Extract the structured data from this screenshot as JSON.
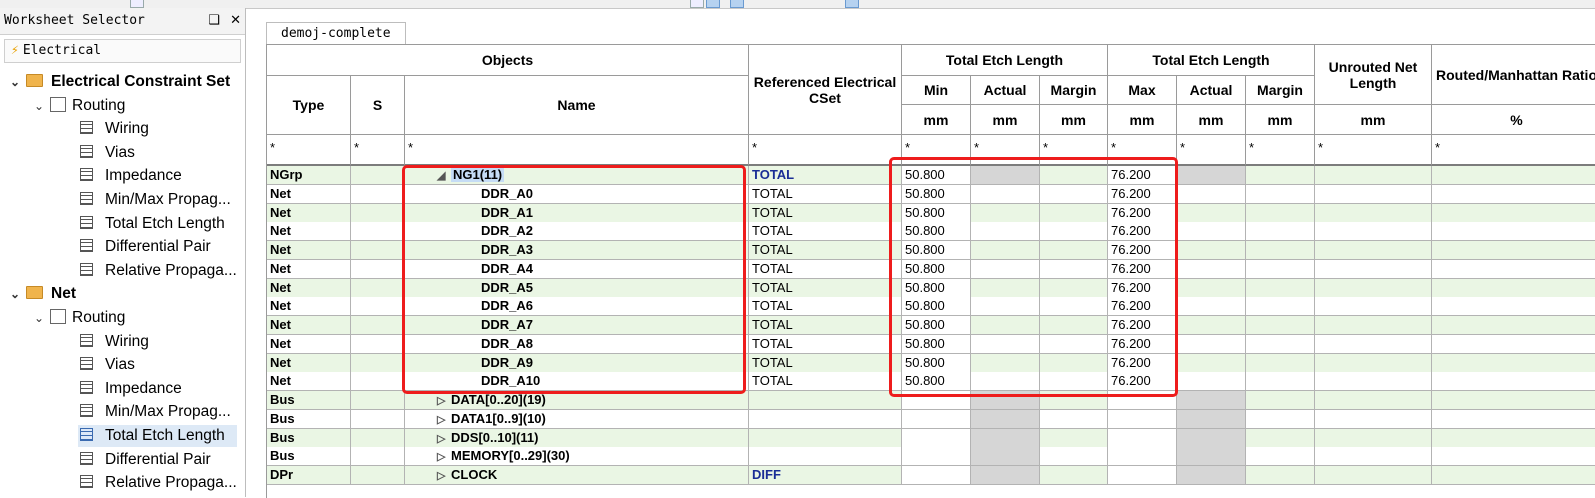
{
  "worksheet_selector": {
    "title": "Worksheet Selector",
    "pin_label": "❑",
    "close_label": "✕",
    "tab_label": "Electrical",
    "tree": [
      {
        "level": 0,
        "label": "Electrical Constraint Set",
        "kind": "folder",
        "expanded": true
      },
      {
        "level": 1,
        "label": "Routing",
        "kind": "routing",
        "expanded": true
      },
      {
        "level": 2,
        "label": "Wiring",
        "kind": "sheet"
      },
      {
        "level": 2,
        "label": "Vias",
        "kind": "sheet"
      },
      {
        "level": 2,
        "label": "Impedance",
        "kind": "sheet"
      },
      {
        "level": 2,
        "label": "Min/Max Propag...",
        "kind": "sheet"
      },
      {
        "level": 2,
        "label": "Total Etch Length",
        "kind": "sheet"
      },
      {
        "level": 2,
        "label": "Differential Pair",
        "kind": "sheet"
      },
      {
        "level": 2,
        "label": "Relative Propaga...",
        "kind": "sheet"
      },
      {
        "level": 0,
        "label": "Net",
        "kind": "folder",
        "expanded": true
      },
      {
        "level": 1,
        "label": "Routing",
        "kind": "routing",
        "expanded": true
      },
      {
        "level": 2,
        "label": "Wiring",
        "kind": "sheet"
      },
      {
        "level": 2,
        "label": "Vias",
        "kind": "sheet"
      },
      {
        "level": 2,
        "label": "Impedance",
        "kind": "sheet"
      },
      {
        "level": 2,
        "label": "Min/Max Propag...",
        "kind": "sheet"
      },
      {
        "level": 2,
        "label": "Total Etch Length",
        "kind": "sheet",
        "selected": true
      },
      {
        "level": 2,
        "label": "Differential Pair",
        "kind": "sheet"
      },
      {
        "level": 2,
        "label": "Relative Propaga...",
        "kind": "sheet"
      }
    ]
  },
  "document_tab": "demoj-complete",
  "headers": {
    "objects": "Objects",
    "type": "Type",
    "s": "S",
    "name": "Name",
    "ref_cset": "Referenced Electrical CSet",
    "tel_min_group": "Total Etch Length",
    "tel_max_group": "Total Etch Length",
    "min": "Min",
    "actual1": "Actual",
    "margin1": "Margin",
    "max": "Max",
    "actual2": "Actual",
    "margin2": "Margin",
    "unrouted": "Unrouted Net Length",
    "ratio": "Routed/Manhattan Ratio",
    "unit_mm": "mm",
    "unit_pct": "%",
    "filter": "*"
  },
  "rows": [
    {
      "type": "NGrp",
      "name": "NG1(11)",
      "expand": "◢",
      "indent": 1,
      "ref": "TOTAL",
      "ref_blue": true,
      "min": "50.800",
      "max": "76.200",
      "selected": true
    },
    {
      "type": "Net",
      "name": "DDR_A0",
      "expand": "",
      "indent": 2,
      "ref": "TOTAL",
      "min": "50.800",
      "max": "76.200"
    },
    {
      "type": "Net",
      "name": "DDR_A1",
      "expand": "",
      "indent": 2,
      "ref": "TOTAL",
      "min": "50.800",
      "max": "76.200"
    },
    {
      "type": "Net",
      "name": "DDR_A2",
      "expand": "",
      "indent": 2,
      "ref": "TOTAL",
      "min": "50.800",
      "max": "76.200"
    },
    {
      "type": "Net",
      "name": "DDR_A3",
      "expand": "",
      "indent": 2,
      "ref": "TOTAL",
      "min": "50.800",
      "max": "76.200"
    },
    {
      "type": "Net",
      "name": "DDR_A4",
      "expand": "",
      "indent": 2,
      "ref": "TOTAL",
      "min": "50.800",
      "max": "76.200"
    },
    {
      "type": "Net",
      "name": "DDR_A5",
      "expand": "",
      "indent": 2,
      "ref": "TOTAL",
      "min": "50.800",
      "max": "76.200"
    },
    {
      "type": "Net",
      "name": "DDR_A6",
      "expand": "",
      "indent": 2,
      "ref": "TOTAL",
      "min": "50.800",
      "max": "76.200"
    },
    {
      "type": "Net",
      "name": "DDR_A7",
      "expand": "",
      "indent": 2,
      "ref": "TOTAL",
      "min": "50.800",
      "max": "76.200"
    },
    {
      "type": "Net",
      "name": "DDR_A8",
      "expand": "",
      "indent": 2,
      "ref": "TOTAL",
      "min": "50.800",
      "max": "76.200"
    },
    {
      "type": "Net",
      "name": "DDR_A9",
      "expand": "",
      "indent": 2,
      "ref": "TOTAL",
      "min": "50.800",
      "max": "76.200"
    },
    {
      "type": "Net",
      "name": "DDR_A10",
      "expand": "",
      "indent": 2,
      "ref": "TOTAL",
      "min": "50.800",
      "max": "76.200"
    },
    {
      "type": "Bus",
      "name": "DATA[0..20](19)",
      "expand": "▷",
      "indent": 1,
      "ref": "",
      "min": "",
      "max": "",
      "gray": true
    },
    {
      "type": "Bus",
      "name": "DATA1[0..9](10)",
      "expand": "▷",
      "indent": 1,
      "ref": "",
      "min": "",
      "max": "",
      "gray": true
    },
    {
      "type": "Bus",
      "name": "DDS[0..10](11)",
      "expand": "▷",
      "indent": 1,
      "ref": "",
      "min": "",
      "max": "",
      "gray": true
    },
    {
      "type": "Bus",
      "name": "MEMORY[0..29](30)",
      "expand": "▷",
      "indent": 1,
      "ref": "",
      "min": "",
      "max": "",
      "gray": true
    },
    {
      "type": "DPr",
      "name": "CLOCK",
      "expand": "▷",
      "indent": 1,
      "ref": "DIFF",
      "ref_blue": true,
      "min": "",
      "max": "",
      "gray": true
    }
  ],
  "colors": {
    "row_green": "#eaf6e4",
    "row_white": "#ffffff",
    "highlight": "#ee1c1c",
    "selection": "#c5dcf5"
  }
}
